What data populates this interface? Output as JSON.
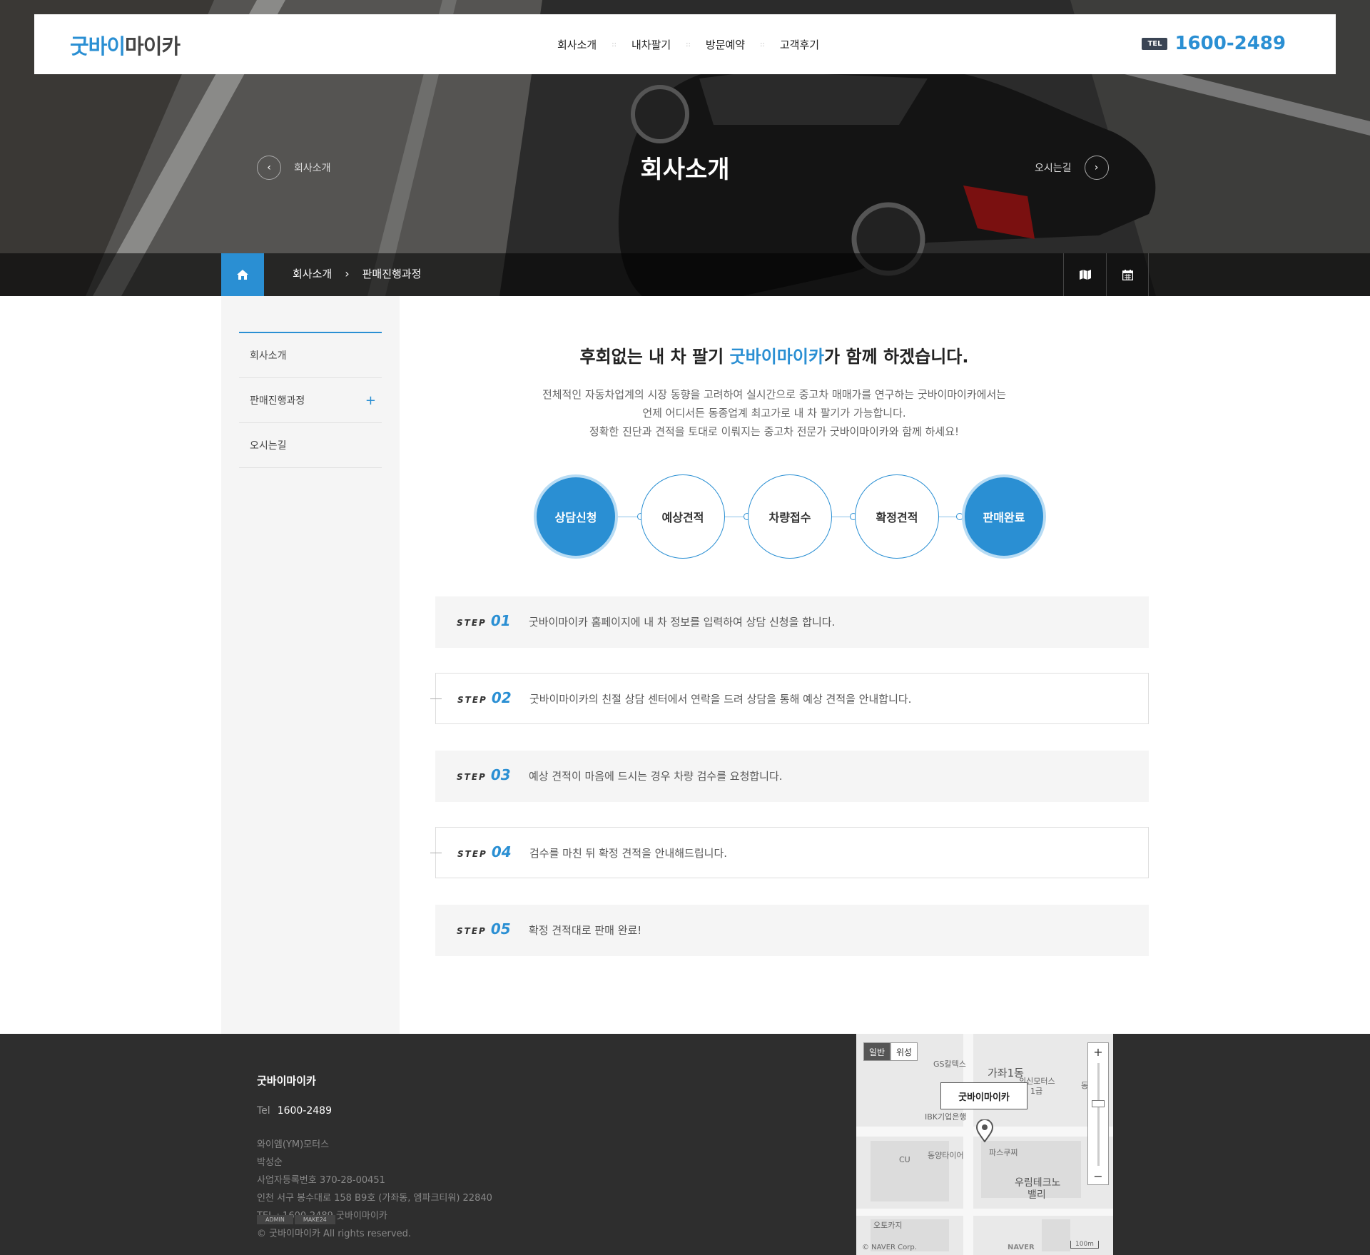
{
  "header": {
    "logo_blue": "굿바이",
    "logo_dark": "마이카",
    "nav": [
      "회사소개",
      "내차팔기",
      "방문예약",
      "고객후기"
    ],
    "nav_sep": "::",
    "tel_badge": "TEL",
    "tel_number": "1600-2489"
  },
  "hero": {
    "title": "회사소개",
    "prev_label": "회사소개",
    "next_label": "오시는길"
  },
  "breadcrumb": {
    "level1": "회사소개",
    "level2": "판매진행과정"
  },
  "sidebar": {
    "items": [
      {
        "label": "회사소개"
      },
      {
        "label": "판매진행과정",
        "expand": "+"
      },
      {
        "label": "오시는길"
      }
    ]
  },
  "content": {
    "headline_pre": "후회없는 내 차 팔기 ",
    "headline_brand": "굿바이마이카",
    "headline_post": "가 함께 하겠습니다.",
    "desc": [
      "전체적인 자동차업계의 시장 동향을 고려하여 실시간으로 중고차 매매가를 연구하는 굿바이마이카에서는",
      "언제 어디서든 동종업계 최고가로 내 차 팔기가 가능합니다.",
      "정확한 진단과 견적을 토대로 이뤄지는 중고차 전문가 굿바이마이카와 함께 하세요!"
    ],
    "process": [
      "상담신청",
      "예상견적",
      "차량접수",
      "확정견적",
      "판매완료"
    ],
    "step_word": "STEP",
    "steps": [
      {
        "num": "01",
        "text": "굿바이마이카 홈페이지에 내 차 정보를 입력하여 상담 신청을 합니다."
      },
      {
        "num": "02",
        "text": "굿바이마이카의 친절 상담 센터에서 연락을 드려 상담을 통해 예상 견적을 안내합니다."
      },
      {
        "num": "03",
        "text": "예상 견적이 마음에 드시는 경우 차량 검수를 요청합니다."
      },
      {
        "num": "04",
        "text": "검수를 마친 뒤 확정 견적을 안내해드립니다."
      },
      {
        "num": "05",
        "text": "확정 견적대로 판매 완료!"
      }
    ]
  },
  "footer": {
    "name": "굿바이마이카",
    "tel_label": "Tel",
    "tel_value": "1600-2489",
    "info": [
      "와이엠(YM)모터스",
      "박성순",
      "사업자등록번호 370-28-00451",
      "인천 서구 봉수대로 158 B9호 (가좌동, 엠파크티워) 22840",
      "TEL : 1600-2489 굿바이마이카"
    ],
    "copyright": "© 굿바이마이카 All rights reserved.",
    "admin_btn": "ADMIN",
    "make_btn": "MAKE24"
  },
  "map": {
    "tab_normal": "일반",
    "tab_satellite": "위성",
    "callout": "굿바이마이카",
    "labels": {
      "gs": "GS칼텍스",
      "gajwa": "가좌1동",
      "wooin": "의신모터스",
      "floor": "1급",
      "ibk": "IBK기업은행",
      "dongyang": "동양타이어",
      "paris": "파스쿠찌",
      "cu": "CU",
      "woorim": "우림테크노",
      "valley": "밸리",
      "auto": "오토카지",
      "naver": "© NAVER Corp.",
      "naver_logo": "NAVER",
      "scale": "100m",
      "dong": "동"
    },
    "zoom_in": "+",
    "zoom_out": "−"
  },
  "colors": {
    "accent": "#2a8fd3",
    "footer_bg": "#2e2e2e",
    "sidebar_bg": "#f5f5f5"
  }
}
